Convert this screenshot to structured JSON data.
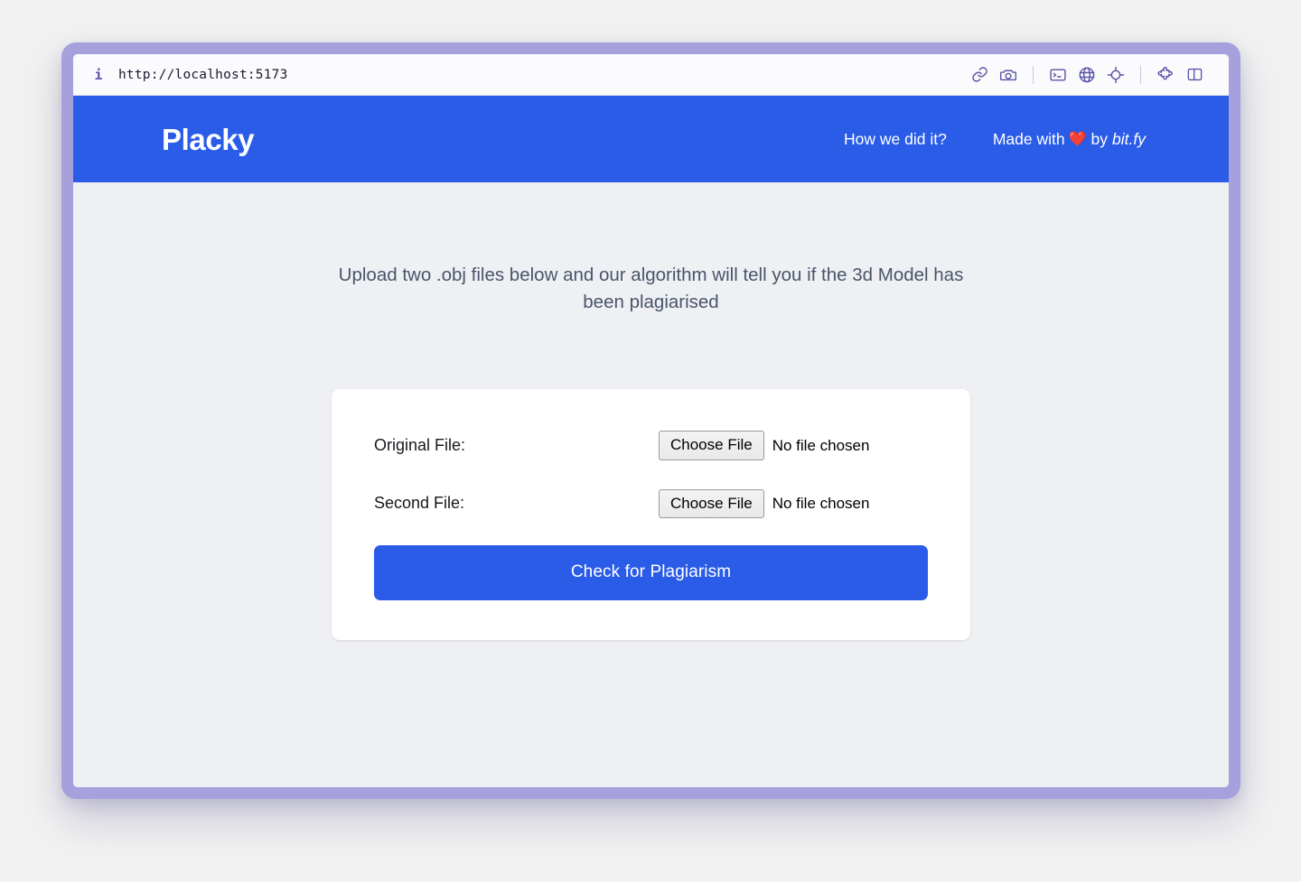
{
  "browser": {
    "info_icon": "info-icon",
    "url": "http://localhost:5173",
    "toolbar_icons": [
      {
        "name": "link-icon",
        "label": "Copy link"
      },
      {
        "name": "camera-icon",
        "label": "Screenshot"
      },
      {
        "name": "divider-1",
        "label": ""
      },
      {
        "name": "terminal-icon",
        "label": "Console"
      },
      {
        "name": "globe-icon",
        "label": "Network"
      },
      {
        "name": "crosshair-icon",
        "label": "Inspect element"
      },
      {
        "name": "divider-2",
        "label": ""
      },
      {
        "name": "puzzle-icon",
        "label": "Extensions"
      },
      {
        "name": "panel-icon",
        "label": "Toggle sidebar"
      }
    ]
  },
  "site": {
    "brand": "Placky",
    "nav": {
      "how_we_did_it": "How we did it?",
      "made_with_prefix": "Made with",
      "heart": "❤️",
      "by": "by",
      "author": "bit.fy"
    }
  },
  "main": {
    "intro": "Upload two .obj files below and our algorithm will tell you if the 3d Model has been plagiarised",
    "form": {
      "rows": [
        {
          "label": "Original File:",
          "button": "Choose File",
          "status": "No file chosen"
        },
        {
          "label": "Second File:",
          "button": "Choose File",
          "status": "No file chosen"
        }
      ],
      "submit": "Check for Plagiarism"
    }
  },
  "colors": {
    "brand_blue": "#2a5ce8",
    "window_chrome": "#a6a1dd",
    "page_background": "#eff0f4",
    "card_background": "#ffffff",
    "intro_text": "#4a5568",
    "desktop_background": "#f2f2f2",
    "heart_red": "#e8223c"
  }
}
